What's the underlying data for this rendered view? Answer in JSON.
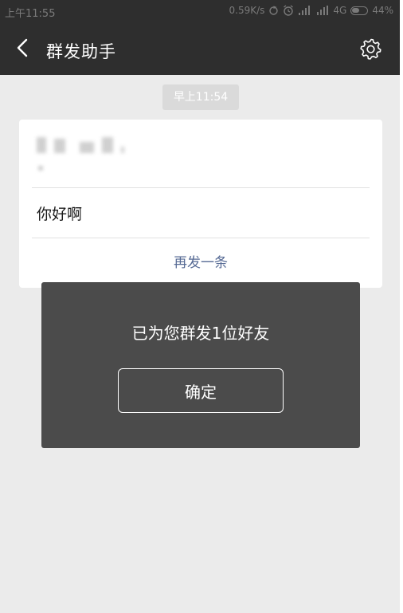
{
  "status_bar": {
    "time": "上午11:55",
    "network_speed": "0.59K/s",
    "network_type": "4G",
    "battery": "44%"
  },
  "header": {
    "title": "群发助手",
    "back_icon": "chevron-left-icon",
    "settings_icon": "gear-icon"
  },
  "chat": {
    "timestamp": "早上11:54",
    "message": "你好啊",
    "resend_label": "再发一条"
  },
  "dialog": {
    "text": "已为您群发1位好友",
    "confirm_label": "确定"
  },
  "colors": {
    "bar_background": "#2e2e2e",
    "page_background": "#ebebeb",
    "dialog_background": "#4b4b4b",
    "link": "#576b95"
  }
}
